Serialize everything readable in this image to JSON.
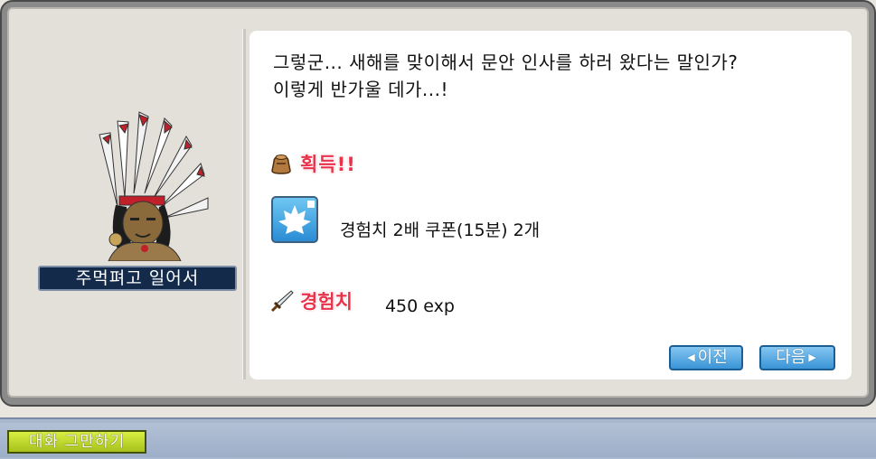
{
  "npc": {
    "name": "주먹펴고 일어서"
  },
  "dialog": {
    "line1": "그렇군... 새해를 맞이해서 문안 인사를 하러 왔다는 말인가?",
    "line2": "이렇게 반가울 데가...!"
  },
  "reward": {
    "title": "획득!!",
    "bag_icon": "bag-icon",
    "item": {
      "icon": "maple-leaf-coupon-icon",
      "text": "경험치 2배 쿠폰(15분) 2개"
    }
  },
  "exp": {
    "icon": "sword-icon",
    "label": "경험치",
    "value": "450 exp"
  },
  "buttons": {
    "prev_label": "이전",
    "next_label": "다음",
    "end_chat_label": "대화 그만하기"
  },
  "colors": {
    "reward_red": "#e8334a",
    "button_blue": "#3a94d6",
    "end_chat_green": "#a7c21c",
    "name_box": "#132a4a"
  }
}
